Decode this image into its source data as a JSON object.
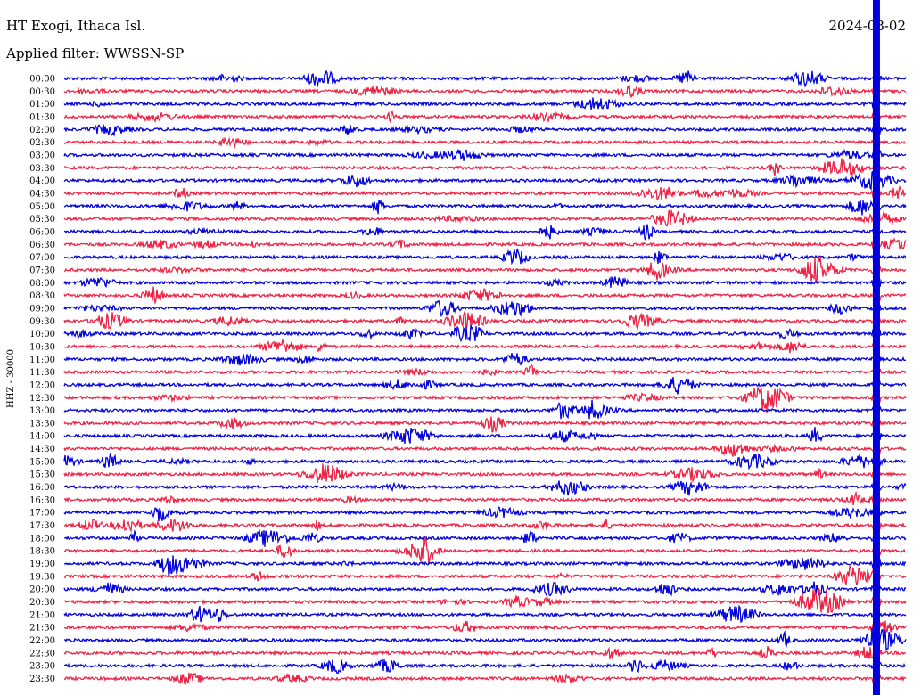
{
  "header": {
    "station": "HT Exogi, Ithaca Isl.",
    "filter": "Applied filter: WWSSN-SP",
    "date": "2024-08-02"
  },
  "chart_data": {
    "type": "helicorder",
    "title": "HT Exogi, Ithaca Isl.",
    "subtitle": "Applied filter: WWSSN-SP",
    "date": "2024-08-02",
    "ylabel": "HHZ - 30000",
    "row_labels": [
      "00:00",
      "00:30",
      "01:00",
      "01:30",
      "02:00",
      "02:30",
      "03:00",
      "03:30",
      "04:00",
      "04:30",
      "05:00",
      "05:30",
      "06:00",
      "06:30",
      "07:00",
      "07:30",
      "08:00",
      "08:30",
      "09:00",
      "09:30",
      "10:00",
      "10:30",
      "11:00",
      "11:30",
      "12:00",
      "12:30",
      "13:00",
      "13:30",
      "14:00",
      "14:30",
      "15:00",
      "15:30",
      "16:00",
      "16:30",
      "17:00",
      "17:30",
      "18:00",
      "18:30",
      "19:00",
      "19:30",
      "20:00",
      "20:30",
      "21:00",
      "21:30",
      "22:00",
      "22:30",
      "23:00",
      "23:30"
    ],
    "series_colors": [
      "#0000dd",
      "#ee2244"
    ],
    "color_pattern": "alternating rows (00:00 blue, 00:30 red, ...)",
    "minutes_per_row": 30,
    "notable_event": {
      "description": "large amplitude event spanning rows 00:00-23:30 near the end of each row",
      "row_fraction": 0.965
    }
  }
}
